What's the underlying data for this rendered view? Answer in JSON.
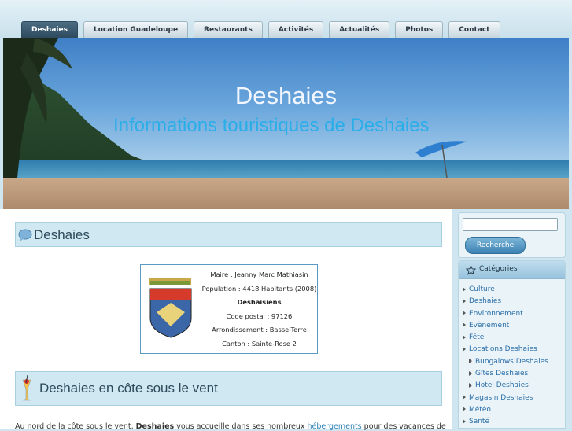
{
  "nav": {
    "items": [
      {
        "label": "Deshaies"
      },
      {
        "label": "Location Guadeloupe"
      },
      {
        "label": "Restaurants"
      },
      {
        "label": "Activités"
      },
      {
        "label": "Actualités"
      },
      {
        "label": "Photos"
      },
      {
        "label": "Contact"
      }
    ],
    "active_index": 0
  },
  "banner": {
    "title": "Deshaies",
    "subtitle": "Informations touristiques de Deshaies"
  },
  "main": {
    "heading": "Deshaies",
    "heading_icon": "speech-bubble-icon",
    "infobox": {
      "crest_icon": "coat-of-arms-icon",
      "rows": [
        "Maire : Jeanny Marc Mathiasin",
        "Population : 4418 Habitants (2008)",
        "Deshaisiens",
        "Code postal : 97126",
        "Arrondissement : Basse-Terre",
        "Canton : Sainte-Rose 2"
      ]
    },
    "section_heading": "Deshaies en côte sous le vent",
    "section_icon": "cocktail-icon",
    "paragraph": {
      "part1": "Au nord de la côte sous le vent, ",
      "bold": "Deshaies",
      "part2": " vous accueille dans ses nombreux ",
      "link": "hébergements",
      "part3": " pour des vacances de"
    }
  },
  "sidebar": {
    "search": {
      "value": "",
      "button_label": "Recherche"
    },
    "categories": {
      "title": "Catégories",
      "icon": "star-icon",
      "items": [
        {
          "label": "Culture",
          "level": 0
        },
        {
          "label": "Deshaies",
          "level": 0
        },
        {
          "label": "Environnement",
          "level": 0
        },
        {
          "label": "Evènement",
          "level": 0
        },
        {
          "label": "Fête",
          "level": 0
        },
        {
          "label": "Locations Deshaies",
          "level": 0
        },
        {
          "label": "Bungalows Deshaies",
          "level": 1
        },
        {
          "label": "Gîtes Deshaies",
          "level": 1
        },
        {
          "label": "Hotel Deshaies",
          "level": 1
        },
        {
          "label": "Magasin Deshaies",
          "level": 0
        },
        {
          "label": "Météo",
          "level": 0
        },
        {
          "label": "Santé",
          "level": 0
        }
      ]
    }
  },
  "colors": {
    "nav_active": "#2d4a5e",
    "heading_bg": "#cfe8f2",
    "link": "#2a7fb8",
    "subtitle": "#2aaee8"
  }
}
